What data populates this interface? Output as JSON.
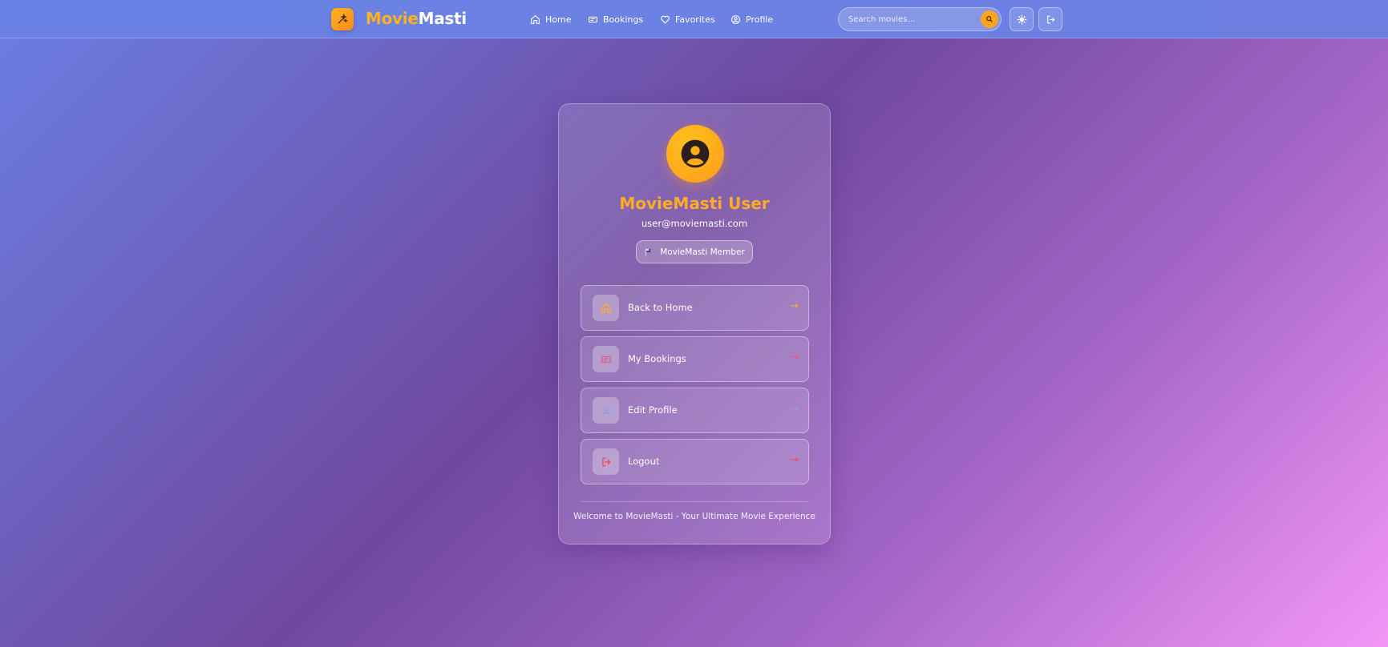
{
  "brand": {
    "name_part1": "Movie",
    "name_part2": "Masti",
    "logo_icon": "sparkle-icon"
  },
  "nav": {
    "links": [
      {
        "label": "Home",
        "icon": "home-icon"
      },
      {
        "label": "Bookings",
        "icon": "ticket-icon"
      },
      {
        "label": "Favorites",
        "icon": "heart-icon"
      },
      {
        "label": "Profile",
        "icon": "user-circle-icon"
      }
    ],
    "search": {
      "placeholder": "Search movies...",
      "icon": "search-icon"
    },
    "theme_toggle_icon": "sun-icon",
    "logout_icon": "logout-icon"
  },
  "profile": {
    "name": "MovieMasti User",
    "email": "user@moviemasti.com",
    "badge": "MovieMasti Member",
    "badge_icon": "flag-icon",
    "avatar_icon": "user-avatar-icon"
  },
  "menu": [
    {
      "label": "Back to Home",
      "icon": "home-icon",
      "arrow": "→",
      "color": "#ffb21c"
    },
    {
      "label": "My Bookings",
      "icon": "ticket-icon",
      "arrow": "→",
      "color": "#e85a7a"
    },
    {
      "label": "Edit Profile",
      "icon": "user-icon",
      "arrow": "→",
      "color": "#8a9cf0"
    },
    {
      "label": "Logout",
      "icon": "logout-icon",
      "arrow": "→",
      "color": "#f04b5b"
    }
  ],
  "footer": "Welcome to MovieMasti - Your Ultimate Movie Experience",
  "colors": {
    "accent": "#ffb21c",
    "primary": "#6a82e6"
  }
}
